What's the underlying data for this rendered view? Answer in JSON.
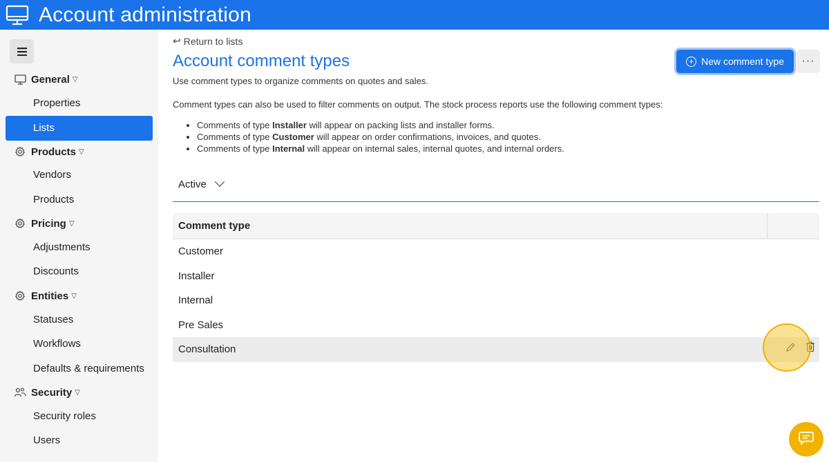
{
  "header": {
    "title": "Account administration",
    "icon": "monitor-icon"
  },
  "sidebar": {
    "menu_icon": "hamburger-icon",
    "sections": [
      {
        "label": "General",
        "icon": "monitor-icon",
        "items": [
          "Properties",
          "Lists"
        ]
      },
      {
        "label": "Products",
        "icon": "gear-icon",
        "items": [
          "Vendors",
          "Products"
        ]
      },
      {
        "label": "Pricing",
        "icon": "gear-icon",
        "items": [
          "Adjustments",
          "Discounts"
        ]
      },
      {
        "label": "Entities",
        "icon": "gear-icon",
        "items": [
          "Statuses",
          "Workflows",
          "Defaults & requirements"
        ]
      },
      {
        "label": "Security",
        "icon": "users-icon",
        "items": [
          "Security roles",
          "Users"
        ]
      }
    ],
    "active_item": "Lists"
  },
  "main": {
    "back_link": "Return to lists",
    "title": "Account comment types",
    "subtitle": "Use comment types to organize comments on quotes and sales.",
    "description": "Comment types can also be used to filter comments on output. The stock process reports use the following comment types:",
    "bullets": [
      {
        "prefix": "Comments of type ",
        "type": "Installer",
        "suffix": " will appear on packing lists and installer forms."
      },
      {
        "prefix": "Comments of type ",
        "type": "Customer",
        "suffix": " will appear on order confirmations, invoices, and quotes."
      },
      {
        "prefix": "Comments of type ",
        "type": "Internal",
        "suffix": " will appear on internal sales, internal quotes, and internal orders."
      }
    ],
    "new_button": "New comment type",
    "more_button": "···",
    "filter": {
      "selected": "Active"
    },
    "table": {
      "header": "Comment type",
      "rows": [
        "Customer",
        "Installer",
        "Internal",
        "Pre Sales",
        "Consultation"
      ],
      "hover_row": "Consultation"
    }
  },
  "colors": {
    "primary": "#1a73e8",
    "highlight": "#f0b400",
    "sidebar_bg": "#f5f5f5"
  }
}
